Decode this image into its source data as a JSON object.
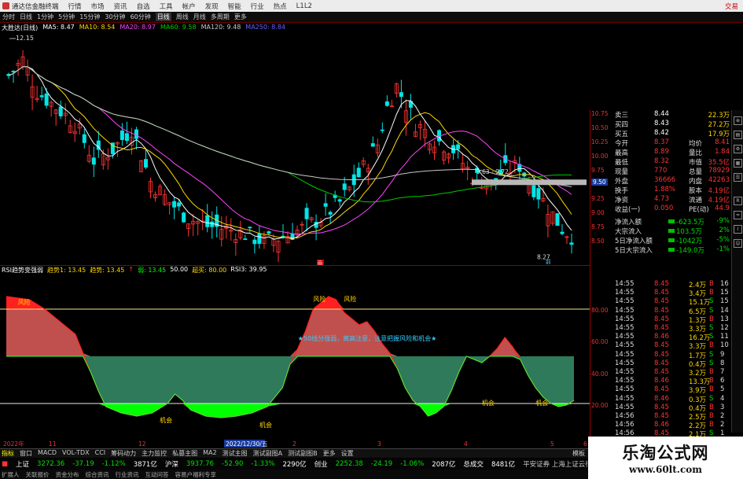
{
  "window": {
    "title": "通达信金融终端",
    "menu": [
      "行情",
      "市场",
      "资讯",
      "自选",
      "工具",
      "帐户",
      "发现",
      "智能",
      "行业",
      "热点",
      "L1L2"
    ],
    "license": "交易"
  },
  "period_bar": {
    "items": [
      "分时",
      "日线",
      "1分钟",
      "5分钟",
      "15分钟",
      "30分钟",
      "60分钟",
      "日线",
      "周线",
      "月线",
      "多周期",
      "更多"
    ],
    "active_index": 7
  },
  "kline_header": {
    "stock_name": "大胜达(日线)",
    "ma5": "MA5: 8.47",
    "ma10": "MA10: 8.54",
    "ma20": "MA20: 8.97",
    "ma60": "MA60: 9.58",
    "ma120": "MA120: 9.48",
    "ma250": "MA250: 8.84",
    "high_label": "12.15",
    "annot_range": "9.63 - 9.72",
    "annot_low": "8.27",
    "annot_cursor": "9.50",
    "marker_box": "画",
    "marker_bottom": "前"
  },
  "price_axis": [
    "10.75",
    "10.50",
    "10.25",
    "10.00",
    "9.75",
    "9.50",
    "9.25",
    "9.00",
    "8.75",
    "8.50"
  ],
  "indicator_header": {
    "name": "RSI趋势变强弱",
    "trend1": "趋势1: 13.45",
    "trend": "趋势: 13.45",
    "up": "↑",
    "weak": "弱: 13.45",
    "mid": "50.00",
    "overbuy": "超买: 80.00",
    "rsi3": "RSI3: 39.95"
  },
  "indicator_axis": [
    "80.00",
    "60.00",
    "40.00",
    "20.00"
  ],
  "indicator_labels": {
    "risk1": "风险",
    "risk2": "风险",
    "risk3": "风险",
    "chance1": "机会",
    "chance2": "机会",
    "chance3": "机会",
    "chance4": "机会",
    "banner": "★50线分强弱，离高注意，注意把握风险和机会★"
  },
  "date_axis": {
    "items": [
      "2022年",
      "11",
      "12",
      "2022/12/30/五",
      "2",
      "3",
      "4",
      "5",
      "6"
    ],
    "highlight": "2022/12/30/五"
  },
  "quote_panel": {
    "rows": [
      {
        "label": "卖三",
        "value": "8.44",
        "vol": "22.3万"
      },
      {
        "label": "买四",
        "value": "8.43",
        "vol": "27.2万"
      },
      {
        "label": "买五",
        "value": "8.42",
        "vol": "17.9万"
      },
      {
        "label": "今开",
        "value": "8.37",
        "label2": "均价",
        "value2": "8.41"
      },
      {
        "label": "最高",
        "value": "8.89",
        "label2": "量比",
        "value2": "1.84"
      },
      {
        "label": "最低",
        "value": "8.32",
        "label2": "市值",
        "value2": "35.5亿"
      },
      {
        "label": "现量",
        "value": "770",
        "label2": "总量",
        "value2": "78929"
      },
      {
        "label": "外盘",
        "value": "36666",
        "label2": "内盘",
        "value2": "42263"
      },
      {
        "label": "换手",
        "value": "1.88%",
        "label2": "股本",
        "value2": "4.19亿"
      },
      {
        "label": "净资",
        "value": "4.73",
        "label2": "流通",
        "value2": "4.19亿"
      },
      {
        "label": "收益(一)",
        "value": "0.050",
        "label2": "PE(动)",
        "value2": "44.9"
      }
    ],
    "flow": [
      {
        "label": "净流入额",
        "value": "-623.5万",
        "pct": "-9%"
      },
      {
        "label": "大宗流入",
        "value": "103.5万",
        "pct": "2%"
      },
      {
        "label": "5日净流入额",
        "value": "-1042万",
        "pct": "-5%"
      },
      {
        "label": "5日大宗流入",
        "value": "-149.0万",
        "pct": "-1%"
      }
    ]
  },
  "ticks": [
    {
      "t": "14:55",
      "p": "8.45",
      "v": "2.4万",
      "d": "B",
      "n": "16"
    },
    {
      "t": "14:55",
      "p": "8.45",
      "v": "3.4万",
      "d": "B",
      "n": "15"
    },
    {
      "t": "14:55",
      "p": "8.45",
      "v": "15.1万",
      "d": "S",
      "n": "15"
    },
    {
      "t": "14:55",
      "p": "8.45",
      "v": "6.5万",
      "d": "S",
      "n": "14"
    },
    {
      "t": "14:55",
      "p": "8.45",
      "v": "1.3万",
      "d": "B",
      "n": "13"
    },
    {
      "t": "14:55",
      "p": "8.45",
      "v": "3.3万",
      "d": "S",
      "n": "12"
    },
    {
      "t": "14:55",
      "p": "8.46",
      "v": "16.2万",
      "d": "S",
      "n": "11"
    },
    {
      "t": "14:55",
      "p": "8.45",
      "v": "3.3万",
      "d": "B",
      "n": "10"
    },
    {
      "t": "14:55",
      "p": "8.45",
      "v": "1.7万",
      "d": "S",
      "n": "9"
    },
    {
      "t": "14:55",
      "p": "8.45",
      "v": "0.4万",
      "d": "S",
      "n": "8"
    },
    {
      "t": "14:55",
      "p": "8.45",
      "v": "3.2万",
      "d": "B",
      "n": "7"
    },
    {
      "t": "14:55",
      "p": "8.46",
      "v": "13.3万",
      "d": "B",
      "n": "6"
    },
    {
      "t": "14:55",
      "p": "8.45",
      "v": "3.9万",
      "d": "B",
      "n": "5"
    },
    {
      "t": "14:55",
      "p": "8.46",
      "v": "0.3万",
      "d": "S",
      "n": "4"
    },
    {
      "t": "14:55",
      "p": "8.45",
      "v": "0.4万",
      "d": "B",
      "n": "3"
    },
    {
      "t": "14:56",
      "p": "8.45",
      "v": "2.5万",
      "d": "B",
      "n": "2"
    },
    {
      "t": "14:56",
      "p": "8.46",
      "v": "2.2万",
      "d": "B",
      "n": "2"
    },
    {
      "t": "14:56",
      "p": "8.45",
      "v": "2.1万",
      "d": "S",
      "n": "1"
    }
  ],
  "bottom_tabs": [
    "指标",
    "窗口",
    "MACD",
    "VOL-TDX",
    "CCI",
    "筹码动力",
    "主力监控",
    "私募主图",
    "MA2",
    "测试主图",
    "测试副图A",
    "测试副图B",
    "更多",
    "设置"
  ],
  "status": {
    "sh_label": "上证",
    "sh_val": "3272.36",
    "sh_chg": "-37.19",
    "sh_pct": "-1.12%",
    "sh_amt": "3871亿",
    "sz_label": "沪深",
    "sz_val": "3937.76",
    "sz_chg": "-52.90",
    "sz_pct": "-1.33%",
    "sz_amt": "2290亿",
    "cy_label": "创业",
    "cy_val": "2252.38",
    "cy_chg": "-24.19",
    "cy_pct": "-1.06%",
    "cy_amt": "2087亿",
    "total_label": "总成交",
    "total_val": "8481亿",
    "broker": "平安证券 上海上证云行情"
  },
  "status2": [
    "扩展人",
    "关联报价",
    "资金分布",
    "综合资讯",
    "行业资讯",
    "互动问答",
    "容易户福利专享"
  ],
  "bottom_right_label": "模板",
  "watermark": {
    "line1": "乐淘公式网",
    "line2": "www.60lt.com"
  },
  "colors": {
    "up": "#ff3333",
    "down": "#00e5e5",
    "ma5": "#ffffff",
    "ma10": "#ffd700",
    "ma20": "#ff44ff",
    "ma60": "#00cc00",
    "ma120": "#c8c8c8",
    "risk_fill": "#c0504d",
    "green_fill": "#2f7a5a",
    "chance_fill": "#00ff00"
  }
}
